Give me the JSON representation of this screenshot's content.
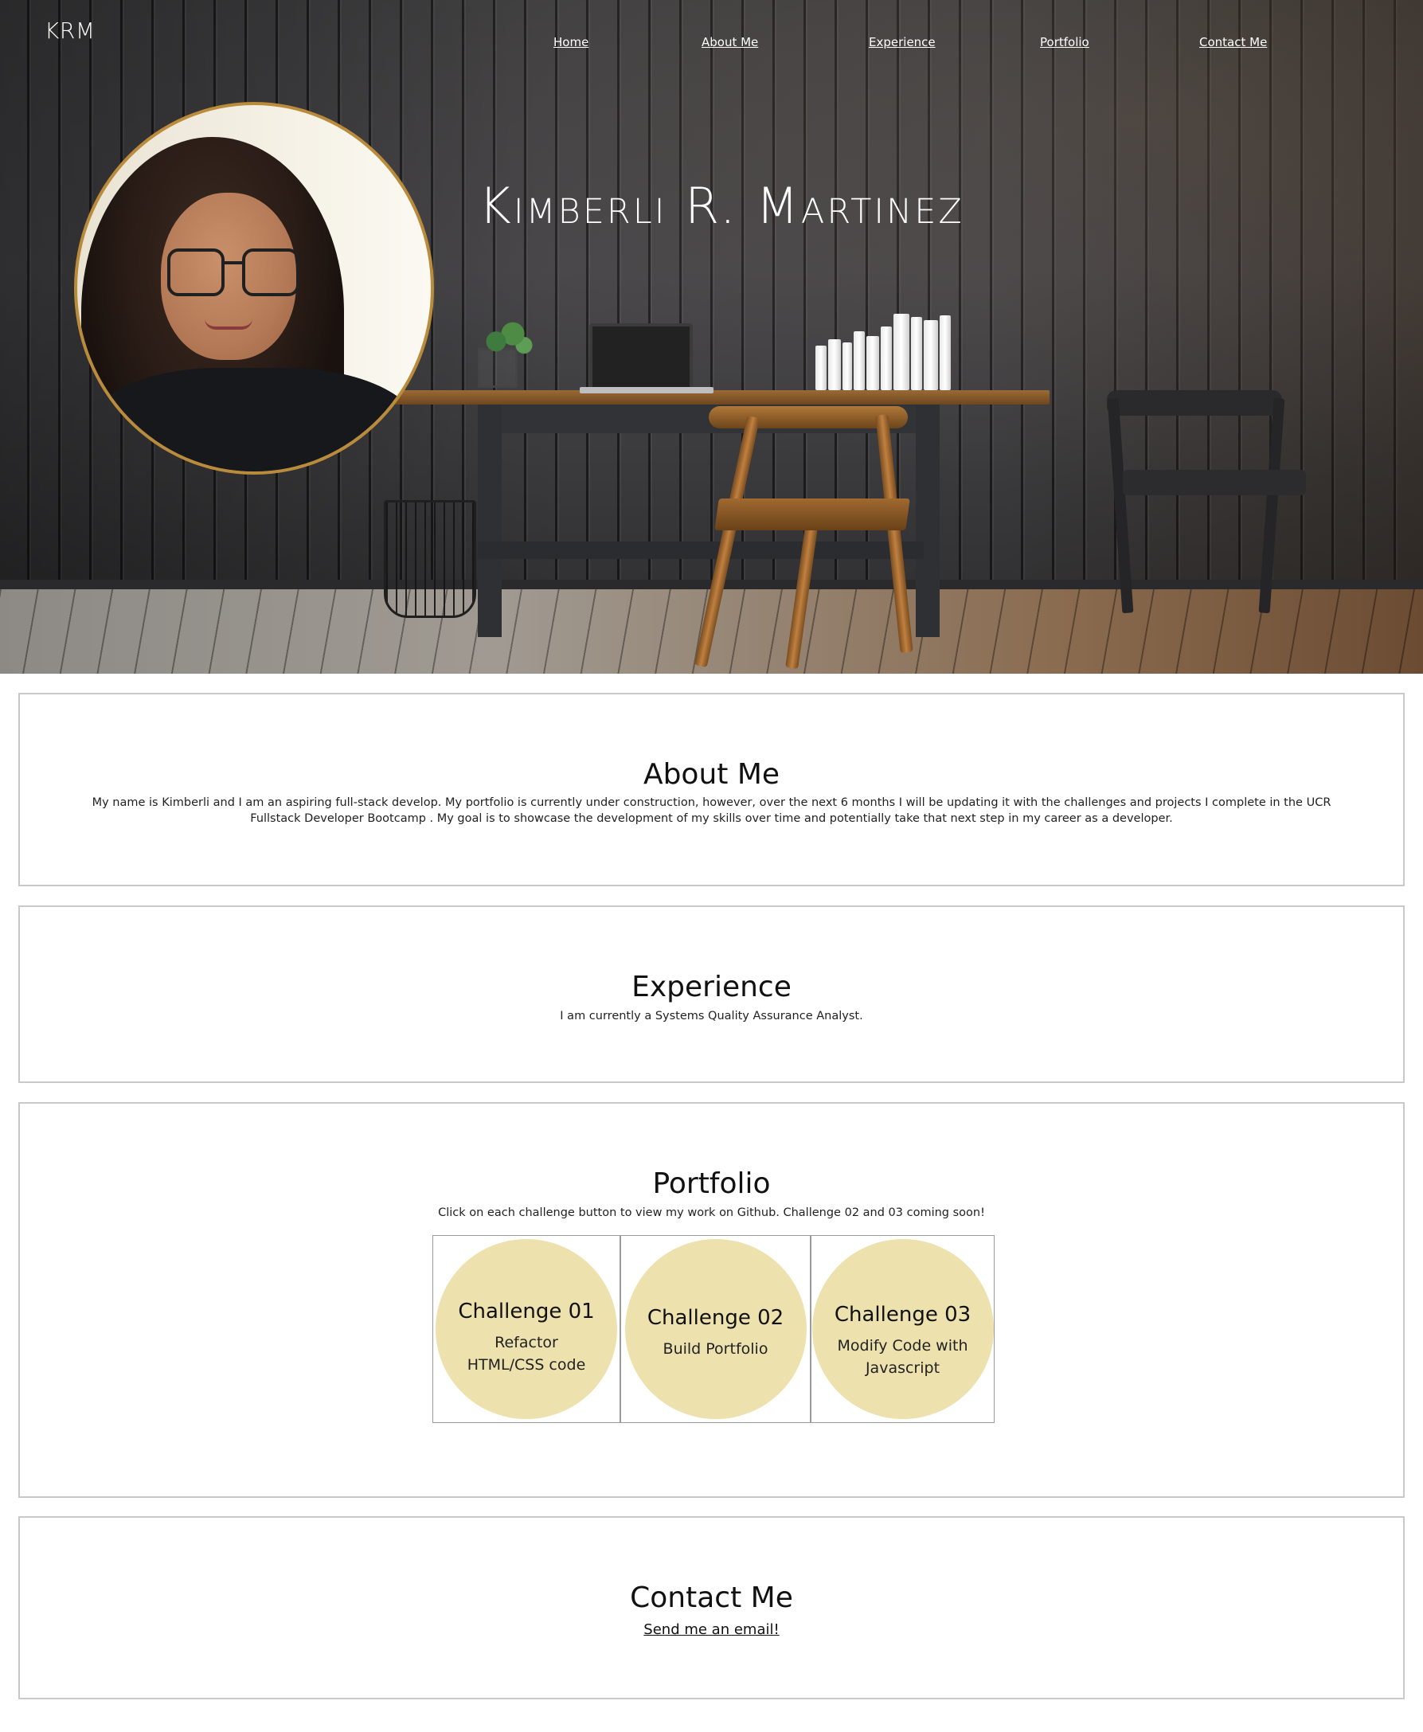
{
  "header": {
    "brand": "KRM",
    "nav": [
      {
        "label": "Home"
      },
      {
        "label": "About Me"
      },
      {
        "label": "Experience"
      },
      {
        "label": "Portfolio"
      },
      {
        "label": "Contact Me"
      }
    ],
    "title": "Kimberli R. Martinez"
  },
  "about": {
    "title": "About Me",
    "text": "My name is Kimberli and I am an aspiring full-stack develop. My portfolio is currently under construction, however, over the next 6 months I will be updating it with the challenges and projects I complete in the UCR Fullstack Developer Bootcamp . My goal is to showcase the development of my skills over time and potentially take that next step in my career as a developer."
  },
  "experience": {
    "title": "Experience",
    "text": "I am currently a Systems Quality Assurance Analyst."
  },
  "portfolio": {
    "title": "Portfolio",
    "text": "Click on each challenge button to view my work on Github. Challenge 02 and 03 coming soon!",
    "cards": [
      {
        "title": "Challenge 01",
        "desc": "Refactor HTML/CSS code"
      },
      {
        "title": "Challenge 02",
        "desc": "Build Portfolio"
      },
      {
        "title": "Challenge 03",
        "desc": "Modify Code with Javascript"
      }
    ]
  },
  "contact": {
    "title": "Contact Me",
    "link": "Send me an email!"
  },
  "colors": {
    "card_circle": "#ede1ad",
    "avatar_border": "#b98b3b",
    "section_border": "#c9c9c9"
  }
}
